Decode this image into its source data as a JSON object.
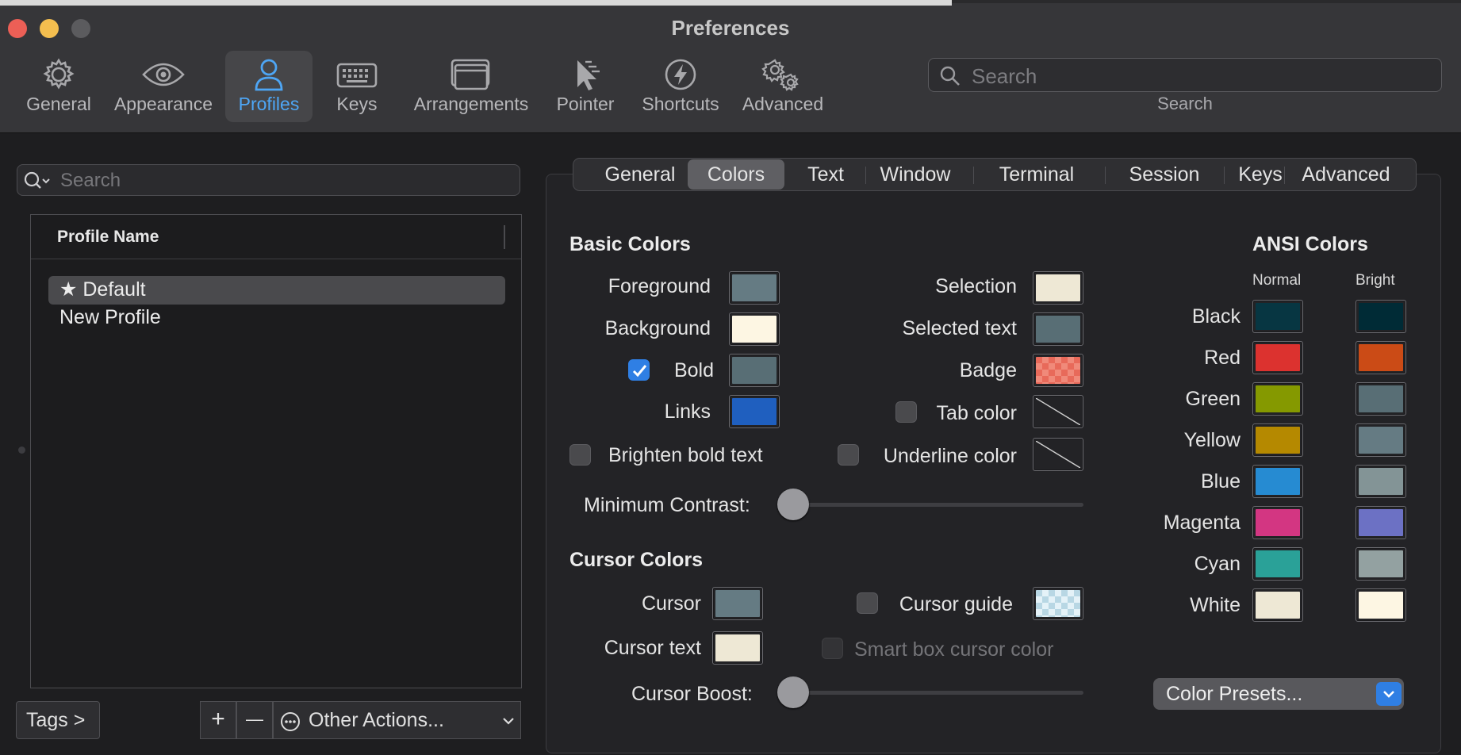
{
  "window": {
    "title": "Preferences"
  },
  "toolbar": {
    "items": [
      {
        "label": "General",
        "icon": "gear-icon"
      },
      {
        "label": "Appearance",
        "icon": "eye-icon"
      },
      {
        "label": "Profiles",
        "icon": "person-icon",
        "active": true
      },
      {
        "label": "Keys",
        "icon": "keyboard-icon"
      },
      {
        "label": "Arrangements",
        "icon": "windows-icon"
      },
      {
        "label": "Pointer",
        "icon": "pointer-icon"
      },
      {
        "label": "Shortcuts",
        "icon": "bolt-icon"
      },
      {
        "label": "Advanced",
        "icon": "gears-icon"
      }
    ],
    "search": {
      "placeholder": "Search",
      "label": "Search"
    }
  },
  "profiles": {
    "search_placeholder": "Search",
    "column_header": "Profile Name",
    "rows": [
      {
        "name": "★ Default",
        "selected": true
      },
      {
        "name": "New Profile",
        "selected": false
      }
    ],
    "buttons": {
      "tags": "Tags >",
      "add": "+",
      "remove": "—",
      "other_actions": "Other Actions..."
    }
  },
  "tabs": {
    "items": [
      "General",
      "Colors",
      "Text",
      "Window",
      "Terminal",
      "Session",
      "Keys",
      "Advanced"
    ],
    "active": "Colors"
  },
  "basic_colors": {
    "heading": "Basic Colors",
    "foreground": {
      "label": "Foreground",
      "color": "#657b83"
    },
    "background": {
      "label": "Background",
      "color": "#fdf6e3"
    },
    "bold": {
      "label": "Bold",
      "color": "#586e75",
      "checked": true
    },
    "links": {
      "label": "Links",
      "color": "#1f5fbf"
    },
    "selection": {
      "label": "Selection",
      "color": "#eee8d5"
    },
    "selected_text": {
      "label": "Selected text",
      "color": "#586e75"
    },
    "badge": {
      "label": "Badge",
      "color": "#f07a6a"
    },
    "tab_color": {
      "label": "Tab color",
      "checked": false
    },
    "brighten_bold": {
      "label": "Brighten bold text",
      "checked": false
    },
    "underline_color": {
      "label": "Underline color",
      "checked": false
    },
    "min_contrast": {
      "label": "Minimum Contrast:",
      "value": 0
    }
  },
  "cursor_colors": {
    "heading": "Cursor Colors",
    "cursor": {
      "label": "Cursor",
      "color": "#657b83"
    },
    "cursor_text": {
      "label": "Cursor text",
      "color": "#eee8d5"
    },
    "cursor_guide": {
      "label": "Cursor guide",
      "checked": false
    },
    "smart_box": {
      "label": "Smart box cursor color",
      "checked": false
    },
    "cursor_boost": {
      "label": "Cursor Boost:",
      "value": 0
    }
  },
  "ansi": {
    "heading": "ANSI Colors",
    "normal_header": "Normal",
    "bright_header": "Bright",
    "rows": [
      {
        "label": "Black",
        "normal": "#073642",
        "bright": "#002b36"
      },
      {
        "label": "Red",
        "normal": "#dc322f",
        "bright": "#cb4b16"
      },
      {
        "label": "Green",
        "normal": "#859900",
        "bright": "#586e75"
      },
      {
        "label": "Yellow",
        "normal": "#b58900",
        "bright": "#657b83"
      },
      {
        "label": "Blue",
        "normal": "#268bd2",
        "bright": "#839496"
      },
      {
        "label": "Magenta",
        "normal": "#d33682",
        "bright": "#6c71c4"
      },
      {
        "label": "Cyan",
        "normal": "#2aa198",
        "bright": "#93a1a1"
      },
      {
        "label": "White",
        "normal": "#eee8d5",
        "bright": "#fdf6e3"
      }
    ],
    "presets_label": "Color Presets..."
  }
}
